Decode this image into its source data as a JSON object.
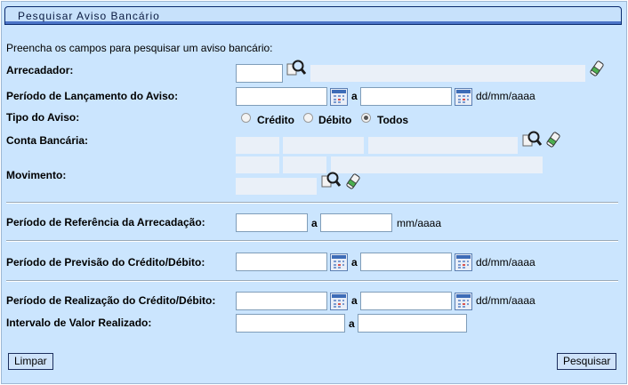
{
  "title": "Pesquisar Aviso Bancário",
  "intro": "Preencha os campos para pesquisar um aviso bancário:",
  "labels": {
    "arrecadador": "Arrecadador:",
    "periodo_lancamento": "Período de Lançamento do Aviso:",
    "tipo_aviso": "Tipo do Aviso:",
    "conta_bancaria": "Conta Bancária:",
    "movimento": "Movimento:",
    "periodo_referencia": "Período de Referência da Arrecadação:",
    "periodo_previsao": "Período de Previsão do Crédito/Débito:",
    "periodo_realizacao": "Período de Realização do Crédito/Débito:",
    "intervalo_valor": "Intervalo de Valor Realizado:"
  },
  "separator": "a",
  "formats": {
    "date": "dd/mm/aaaa",
    "month": "mm/aaaa"
  },
  "tipo_options": [
    {
      "label": "Crédito",
      "selected": false
    },
    {
      "label": "Débito",
      "selected": false
    },
    {
      "label": "Todos",
      "selected": true
    }
  ],
  "buttons": {
    "limpar": "Limpar",
    "pesquisar": "Pesquisar"
  },
  "colors": {
    "panel_bg": "#cbe5fe",
    "title_border": "#0a2a6e"
  }
}
